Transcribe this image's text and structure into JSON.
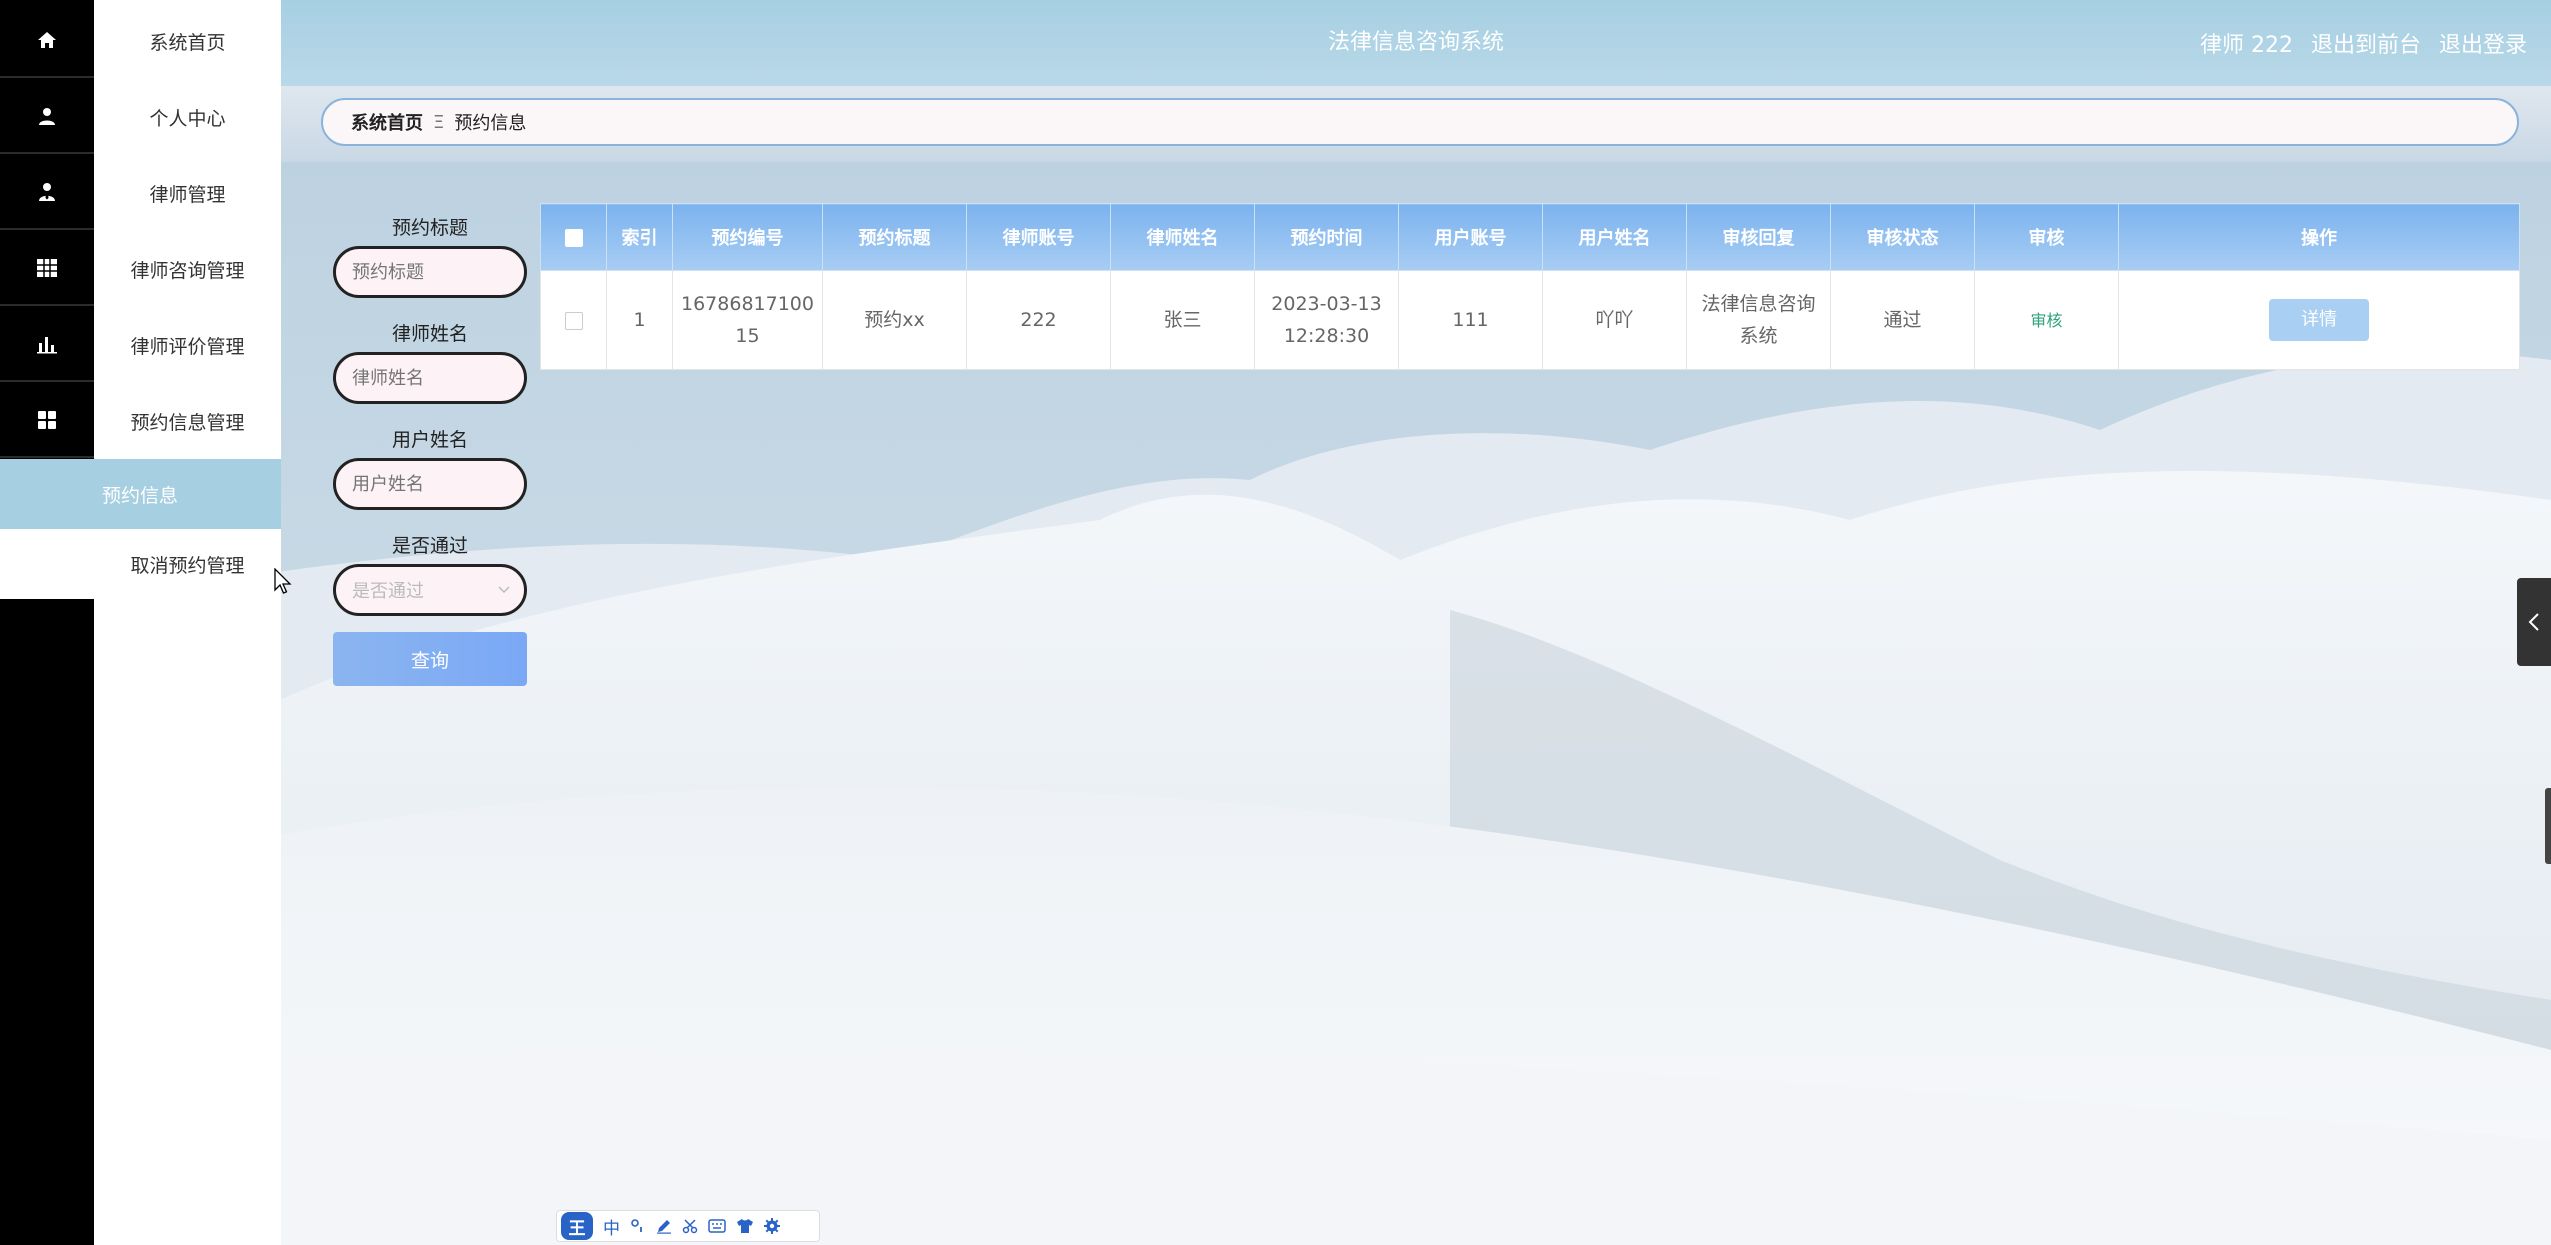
{
  "header": {
    "title": "法律信息咨询系统",
    "user_label": "律师 222",
    "to_front_label": "退出到前台",
    "logout_label": "退出登录"
  },
  "sidebar": {
    "items": [
      {
        "label": "系统首页",
        "icon": "home-icon"
      },
      {
        "label": "个人中心",
        "icon": "person-icon"
      },
      {
        "label": "律师管理",
        "icon": "user-tie-icon"
      },
      {
        "label": "律师咨询管理",
        "icon": "grid-table-icon"
      },
      {
        "label": "律师评价管理",
        "icon": "bar-chart-icon"
      },
      {
        "label": "预约信息管理",
        "icon": "apps-icon"
      }
    ],
    "subitems": [
      {
        "label": "预约信息",
        "active": true
      },
      {
        "label": "取消预约管理",
        "active": false
      }
    ]
  },
  "breadcrumb": {
    "home": "系统首页",
    "separator": "Ξ",
    "current": "预约信息"
  },
  "search": {
    "title_label": "预约标题",
    "title_placeholder": "预约标题",
    "lawyer_label": "律师姓名",
    "lawyer_placeholder": "律师姓名",
    "user_label": "用户姓名",
    "user_placeholder": "用户姓名",
    "pass_label": "是否通过",
    "pass_placeholder": "是否通过",
    "query_button": "查询"
  },
  "table": {
    "headers": [
      "索引",
      "预约编号",
      "预约标题",
      "律师账号",
      "律师姓名",
      "预约时间",
      "用户账号",
      "用户姓名",
      "审核回复",
      "审核状态",
      "审核",
      "操作"
    ],
    "rows": [
      {
        "index": "1",
        "number_line1": "16786817100",
        "number_line2": "15",
        "title": "预约xx",
        "lawyer_account": "222",
        "lawyer_name": "张三",
        "time_line1": "2023-03-13",
        "time_line2": "12:28:30",
        "user_account": "111",
        "user_name": "吖吖",
        "reply_line1": "法律信息咨询",
        "reply_line2": "系统",
        "status": "通过",
        "audit": "审核",
        "action": "详情"
      }
    ]
  },
  "ime": {
    "logo": "王",
    "mode": "中"
  },
  "colors": {
    "header_bg": "#a6cfe2",
    "active_menu": "#a7cfe2",
    "table_header": "#7cb3ee",
    "query_button": "#8bb5f0",
    "audit_green": "#2ea37a"
  }
}
